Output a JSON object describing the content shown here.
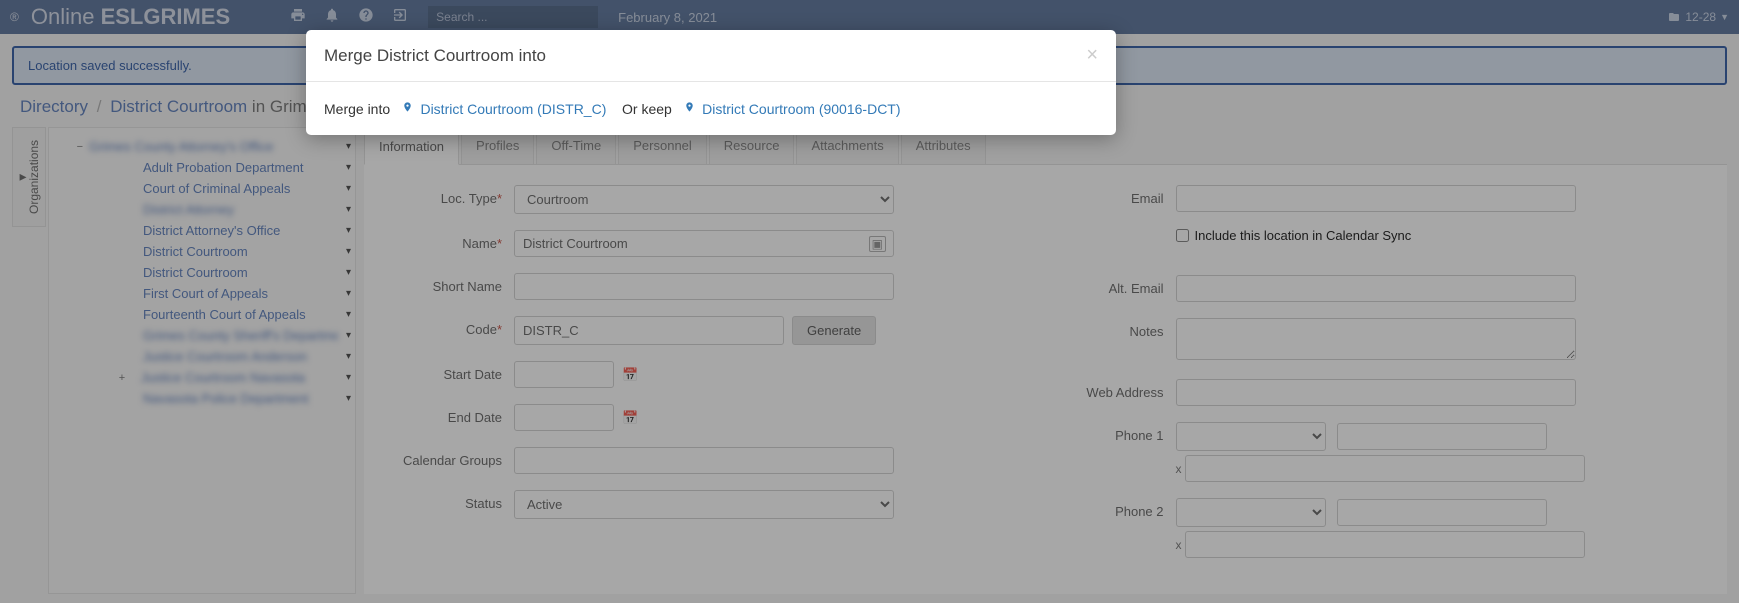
{
  "topbar": {
    "brand_prefix": "Online",
    "brand_suffix": "ESLGRIMES",
    "search_placeholder": "Search ...",
    "date": "February 8, 2021",
    "right_badge": "12-28"
  },
  "alert": {
    "message": "Location saved successfully."
  },
  "breadcrumb": {
    "root": "Directory",
    "item": "District Courtroom",
    "suffix": "in Grimes County"
  },
  "sidebar": {
    "tab_label": "Organizations",
    "items": [
      {
        "label": "Grimes County Attorney's Office",
        "blur": true,
        "expand": "−"
      },
      {
        "label": "Adult Probation Department",
        "blur": false
      },
      {
        "label": "Court of Criminal Appeals",
        "blur": false
      },
      {
        "label": "District Attorney",
        "blur": true
      },
      {
        "label": "District Attorney's Office",
        "blur": false
      },
      {
        "label": "District Courtroom",
        "blur": false
      },
      {
        "label": "District Courtroom",
        "blur": false
      },
      {
        "label": "First Court of Appeals",
        "blur": false
      },
      {
        "label": "Fourteenth Court of Appeals",
        "blur": false
      },
      {
        "label": "Grimes County Sheriff's Department",
        "blur": true
      },
      {
        "label": "Justice Courtroom Anderson",
        "blur": true
      },
      {
        "label": "Justice Courtroom Navasota",
        "blur": true,
        "expand": "+"
      },
      {
        "label": "Navasota Police Department",
        "blur": true
      }
    ]
  },
  "tabs": [
    "Information",
    "Profiles",
    "Off-Time",
    "Personnel",
    "Resource",
    "Attachments",
    "Attributes"
  ],
  "form": {
    "loc_type_label": "Loc. Type",
    "loc_type_value": "Courtroom",
    "name_label": "Name",
    "name_value": "District Courtroom",
    "short_name_label": "Short Name",
    "code_label": "Code",
    "code_value": "DISTR_C",
    "generate_btn": "Generate",
    "start_date_label": "Start Date",
    "end_date_label": "End Date",
    "calendar_groups_label": "Calendar Groups",
    "status_label": "Status",
    "status_value": "Active",
    "email_label": "Email",
    "sync_checkbox": "Include this location in Calendar Sync",
    "alt_email_label": "Alt. Email",
    "notes_label": "Notes",
    "web_address_label": "Web Address",
    "phone1_label": "Phone 1",
    "phone2_label": "Phone 2",
    "ext_label": "x"
  },
  "modal": {
    "title": "Merge District Courtroom into",
    "merge_into_label": "Merge into",
    "option1": "District Courtroom (DISTR_C)",
    "or_keep_label": "Or keep",
    "option2": "District Courtroom (90016-DCT)"
  }
}
